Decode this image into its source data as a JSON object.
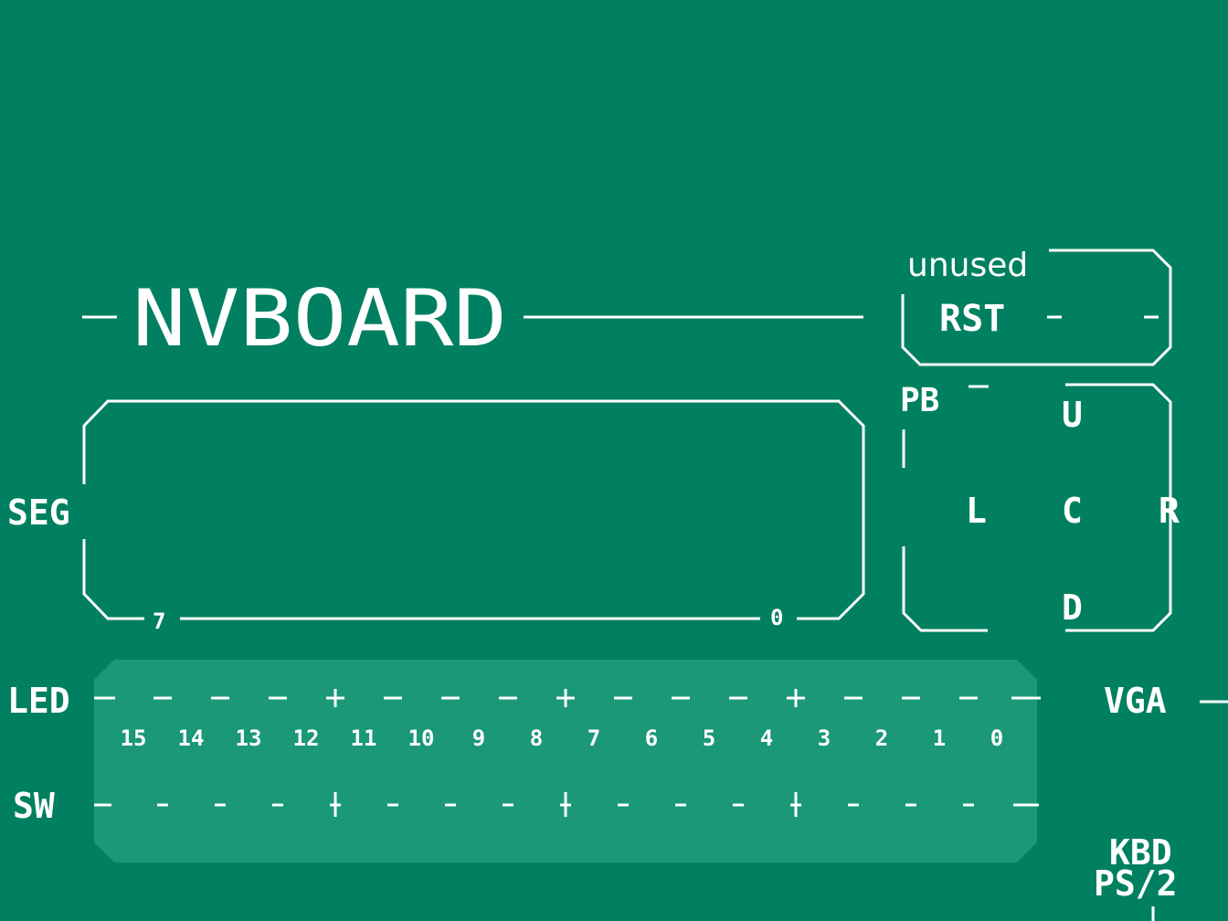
{
  "board": {
    "title": "NVBOARD",
    "background_color": "#008060",
    "panel_color": "#1a9878",
    "line_color": "#ffffff"
  },
  "reset": {
    "note": "unused",
    "label": "RST"
  },
  "seg": {
    "label": "SEG",
    "index_left": "7",
    "index_right": "0"
  },
  "pb": {
    "label": "PB",
    "up": "U",
    "left": "L",
    "center": "C",
    "right": "R",
    "down": "D"
  },
  "led": {
    "label": "LED",
    "states": [
      "-",
      "-",
      "-",
      "+",
      "-",
      "-",
      "-",
      "+",
      "-",
      "-",
      "-",
      "+",
      "-",
      "-",
      "-",
      "-"
    ]
  },
  "indices": [
    "15",
    "14",
    "13",
    "12",
    "11",
    "10",
    "9",
    "8",
    "7",
    "6",
    "5",
    "4",
    "3",
    "2",
    "1",
    "0"
  ],
  "sw": {
    "label": "SW",
    "states": [
      "-",
      "-",
      "-",
      "+",
      "-",
      "-",
      "-",
      "+",
      "-",
      "-",
      "-",
      "+",
      "-",
      "-",
      "-",
      "-"
    ]
  },
  "vga": {
    "label": "VGA"
  },
  "kbd": {
    "label_line1": "KBD",
    "label_line2": "PS/2"
  }
}
